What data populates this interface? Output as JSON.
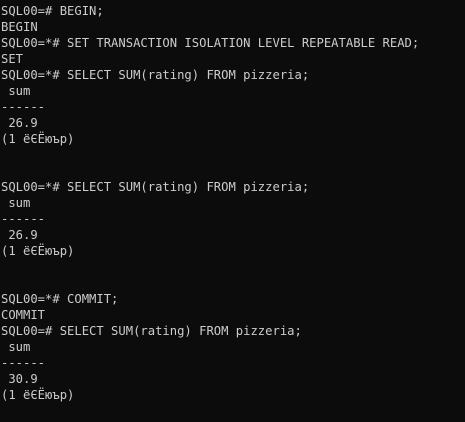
{
  "terminal": {
    "lines": [
      "SQL00=# BEGIN;",
      "BEGIN",
      "SQL00=*# SET TRANSACTION ISOLATION LEVEL REPEATABLE READ;",
      "SET",
      "SQL00=*# SELECT SUM(rating) FROM pizzeria;",
      " sum",
      "------",
      " 26.9",
      "(1 ёЄЁюър)",
      "",
      "",
      "SQL00=*# SELECT SUM(rating) FROM pizzeria;",
      " sum",
      "------",
      " 26.9",
      "(1 ёЄЁюър)",
      "",
      "",
      "SQL00=*# COMMIT;",
      "COMMIT",
      "SQL00=# SELECT SUM(rating) FROM pizzeria;",
      " sum",
      "------",
      " 30.9",
      "(1 ёЄЁюър)",
      ""
    ]
  }
}
